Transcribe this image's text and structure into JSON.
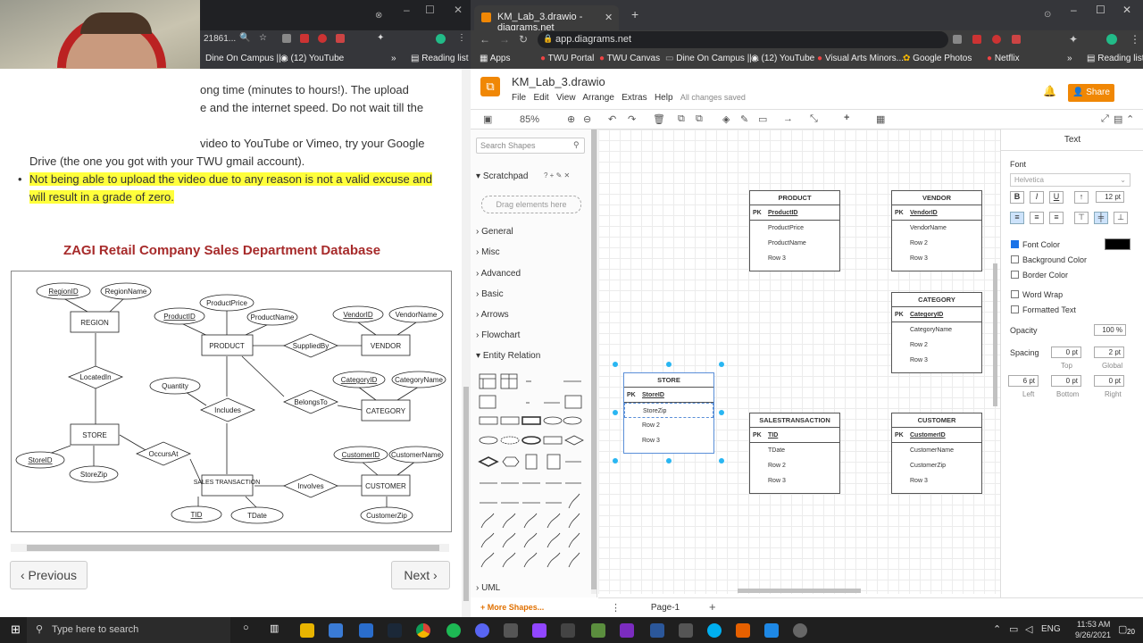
{
  "left_browser": {
    "address_fragment": "21861...",
    "bookmarks": [
      "Dine On Campus ||...",
      "(12) YouTube",
      "Reading list"
    ],
    "content": {
      "line1": "ong time (minutes to hours!). The upload",
      "line2": "e and the internet speed. Do not wait till the",
      "line3": "video to YouTube or Vimeo, try your Google",
      "line4": "Drive (the one you got with your TWU gmail account).",
      "bullet_highlight": "Not being able to upload the video due to any reason is not a valid excuse and will result in a grade of zero.",
      "diagram_title": "ZAGI Retail Company Sales Department Database",
      "prev": "‹ Previous",
      "next": "Next ›"
    },
    "er": {
      "region": "REGION",
      "regionid": "RegionID",
      "regionname": "RegionName",
      "product": "PRODUCT",
      "productid": "ProductID",
      "productprice": "ProductPrice",
      "productname": "ProductName",
      "vendor": "VENDOR",
      "vendorid": "VendorID",
      "vendorname": "VendorName",
      "category": "CATEGORY",
      "categoryid": "CategoryID",
      "categoryname": "CategoryName",
      "store": "STORE",
      "storeid": "StoreID",
      "storezip": "StoreZip",
      "sales": "SALES TRANSACTION",
      "tid": "TID",
      "tdate": "TDate",
      "customer": "CUSTOMER",
      "customerid": "CustomerID",
      "customername": "CustomerName",
      "customerzip": "CustomerZip",
      "suppliedby": "SuppliedBy",
      "belongsto": "BelongsTo",
      "locatedin": "LocatedIn",
      "includes": "Includes",
      "occursat": "OccursAt",
      "involves": "Involves",
      "quantity": "Quantity"
    }
  },
  "right_browser": {
    "tab_title": "KM_Lab_3.drawio - diagrams.net",
    "url": "app.diagrams.net",
    "bookmarks": [
      "Apps",
      "TWU Portal",
      "TWU Canvas",
      "Dine On Campus ||...",
      "(12) YouTube",
      "Visual Arts Minors...",
      "Google Photos",
      "Netflix",
      "Reading list"
    ],
    "drawio": {
      "file_name": "KM_Lab_3.drawio",
      "menu": [
        "File",
        "Edit",
        "View",
        "Arrange",
        "Extras",
        "Help"
      ],
      "saved": "All changes saved",
      "share": "Share",
      "zoom": "85%",
      "search_placeholder": "Search Shapes",
      "scratchpad": "Scratchpad",
      "scratch_hint": "? + ✎ ✕",
      "drag_here": "Drag elements here",
      "sections": [
        "General",
        "Misc",
        "Advanced",
        "Basic",
        "Arrows",
        "Flowchart",
        "Entity Relation"
      ],
      "uml": "UML",
      "more_shapes": "+ More Shapes...",
      "page_tab": "Page-1",
      "format": {
        "tab": "Text",
        "font_label": "Font",
        "font": "Helvetica",
        "size": "12 pt",
        "font_color": "Font Color",
        "background_color": "Background Color",
        "border_color": "Border Color",
        "word_wrap": "Word Wrap",
        "formatted_text": "Formatted Text",
        "opacity_label": "Opacity",
        "opacity": "100 %",
        "spacing_label": "Spacing",
        "top_val": "0 pt",
        "global_val": "2 pt",
        "top": "Top",
        "global": "Global",
        "left_val": "6 pt",
        "bottom_val": "0 pt",
        "right_val": "0 pt",
        "left": "Left",
        "bottom": "Bottom",
        "right": "Right"
      },
      "tables": {
        "product": {
          "title": "PRODUCT",
          "pk": "ProductID",
          "rows": [
            "ProductPrice",
            "ProductName",
            "Row 3"
          ]
        },
        "vendor": {
          "title": "VENDOR",
          "pk": "VendorID",
          "rows": [
            "VendorName",
            "Row 2",
            "Row 3"
          ]
        },
        "category": {
          "title": "CATEGORY",
          "pk": "CategoryID",
          "rows": [
            "CategoryName",
            "Row 2",
            "Row 3"
          ]
        },
        "store": {
          "title": "STORE",
          "pk": "StoreID",
          "rows": [
            "StoreZip",
            "Row 2",
            "Row 3"
          ]
        },
        "sales": {
          "title": "SALESTRANSACTION",
          "pk": "TID",
          "rows": [
            "TDate",
            "Row 2",
            "Row 3"
          ]
        },
        "customer": {
          "title": "CUSTOMER",
          "pk": "CustomerID",
          "rows": [
            "CustomerName",
            "CustomerZip",
            "Row 3"
          ]
        }
      },
      "pk_label": "PK"
    }
  },
  "taskbar": {
    "search": "Type here to search",
    "time": "11:53 AM",
    "date": "9/26/2021",
    "lang": "ENG",
    "badge": "20"
  },
  "colors": {
    "accent": "#f08705",
    "highlight": "#ffff3b",
    "title_red": "#a72b2b"
  }
}
